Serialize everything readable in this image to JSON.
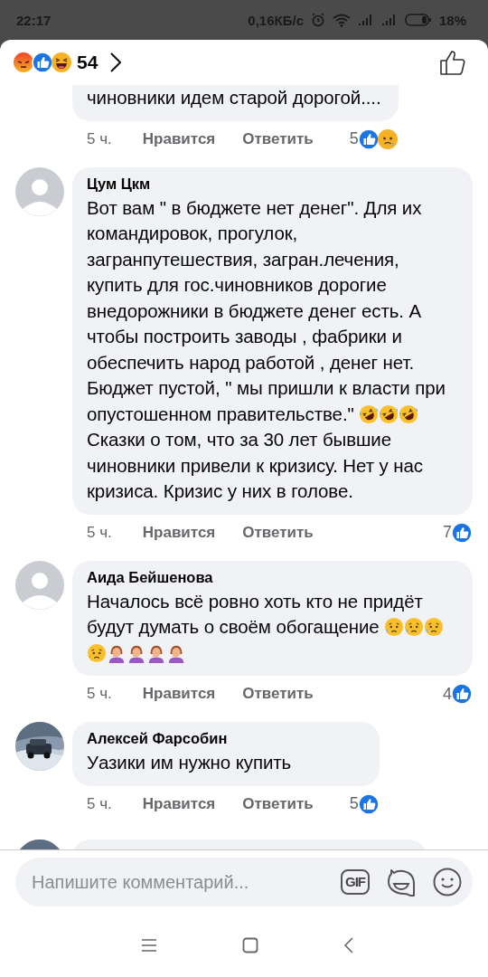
{
  "status_bar": {
    "time": "22:17",
    "speed": "0,16КБ/с",
    "battery": "18%"
  },
  "header": {
    "reactions": [
      {
        "kind": "angry"
      },
      {
        "kind": "like"
      },
      {
        "kind": "haha"
      }
    ],
    "count": "54"
  },
  "comments": [
    {
      "kind": "cut-top",
      "body": [
        {
          "kind": "text",
          "text": "чиновники идем старой дорогой...."
        }
      ],
      "time": "5 ч.",
      "like": "Нравится",
      "reply": "Ответить",
      "reaction_count": "5",
      "reactions": [
        {
          "kind": "like"
        },
        {
          "kind": "sad"
        }
      ]
    },
    {
      "kind": "comment",
      "avatar": {
        "kind": "default"
      },
      "author": "Цум Цкм",
      "body": [
        {
          "kind": "text",
          "text": "Вот вам \" в бюджете нет денег\". Для их командировок, прогулок, загранпутешествия, загран.лечения, купить для гос.чиновников дорогие внедорожники в бюджете денег есть. А чтобы построить заводы , фабрики и обеспечить народ работой , денег нет. Бюджет пустой, \" мы пришли к власти при опустошенном правительстве.\" "
        },
        {
          "kind": "rofl"
        },
        {
          "kind": "rofl"
        },
        {
          "kind": "rofl"
        },
        {
          "kind": "text",
          "text": " Сказки о том, что за 30 лет бывшие чиновники привели к кризису. Нет у нас кризиса. Кризис у них в голове."
        }
      ],
      "time": "5 ч.",
      "like": "Нравится",
      "reply": "Ответить",
      "reaction_count": "7",
      "reactions": [
        {
          "kind": "like"
        }
      ]
    },
    {
      "kind": "comment",
      "avatar": {
        "kind": "default"
      },
      "author": "Аида Бейшенова",
      "body": [
        {
          "kind": "text",
          "text": "Началось всё ровно хоть кто не придёт будут думать о своём обогащение "
        },
        {
          "kind": "crying"
        },
        {
          "kind": "crying"
        },
        {
          "kind": "crying"
        },
        {
          "kind": "crying"
        },
        {
          "kind": "facepalm"
        },
        {
          "kind": "facepalm"
        },
        {
          "kind": "facepalm"
        },
        {
          "kind": "facepalm"
        }
      ],
      "time": "5 ч.",
      "like": "Нравится",
      "reply": "Ответить",
      "reaction_count": "4",
      "reactions": [
        {
          "kind": "like"
        }
      ]
    },
    {
      "kind": "comment",
      "avatar": {
        "kind": "picture"
      },
      "author": "Алексей Фарсобин",
      "body": [
        {
          "kind": "text",
          "text": "Уазики им нужно купить"
        }
      ],
      "time": "5 ч.",
      "like": "Нравится",
      "reply": "Ответить",
      "reaction_count": "5",
      "reactions": [
        {
          "kind": "like"
        }
      ]
    },
    {
      "kind": "cut-bottom",
      "avatar": {
        "kind": "picture"
      }
    }
  ],
  "composer": {
    "placeholder": "Напишите комментарий...",
    "gif": "GIF"
  }
}
